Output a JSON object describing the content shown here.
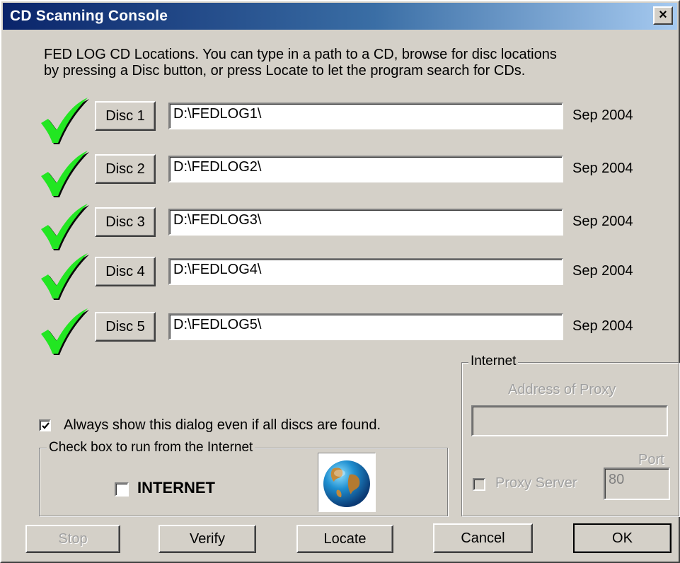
{
  "window": {
    "title": "CD Scanning Console",
    "close_label": "×"
  },
  "instructions": {
    "line1": "FED LOG CD Locations. You can type in a path to a CD, browse for disc locations",
    "line2": "by pressing a Disc button, or press Locate to let the program search for CDs."
  },
  "discs": [
    {
      "button": "Disc 1",
      "path": "D:\\FEDLOG1\\",
      "date": "Sep 2004",
      "status": "found-checkmark-icon"
    },
    {
      "button": "Disc 2",
      "path": "D:\\FEDLOG2\\",
      "date": "Sep 2004",
      "status": "found-checkmark-icon"
    },
    {
      "button": "Disc 3",
      "path": "D:\\FEDLOG3\\",
      "date": "Sep 2004",
      "status": "found-checkmark-icon"
    },
    {
      "button": "Disc 4",
      "path": "D:\\FEDLOG4\\",
      "date": "Sep 2004",
      "status": "found-checkmark-icon"
    },
    {
      "button": "Disc 5",
      "path": "D:\\FEDLOG5\\",
      "date": "Sep 2004",
      "status": "found-checkmark-icon"
    }
  ],
  "always_show": {
    "label": "Always show this dialog even if all discs are found.",
    "checked": true
  },
  "internet_run_group": {
    "legend": "Check box to run from the Internet",
    "checkbox_label": "INTERNET",
    "checked": false,
    "icon": "globe-icon"
  },
  "internet_group": {
    "legend": "Internet",
    "proxy_address_label": "Address of Proxy",
    "proxy_address_value": "",
    "port_label": "Port",
    "port_value": "80",
    "proxy_server_label": "Proxy Server",
    "proxy_server_checked": false
  },
  "buttons": {
    "stop": "Stop",
    "verify": "Verify",
    "locate": "Locate",
    "cancel": "Cancel",
    "ok": "OK"
  },
  "colors": {
    "titlebar_start": "#0a246a",
    "titlebar_end": "#a6caf0",
    "face": "#d4d0c8",
    "checkmark": "#22e622"
  }
}
